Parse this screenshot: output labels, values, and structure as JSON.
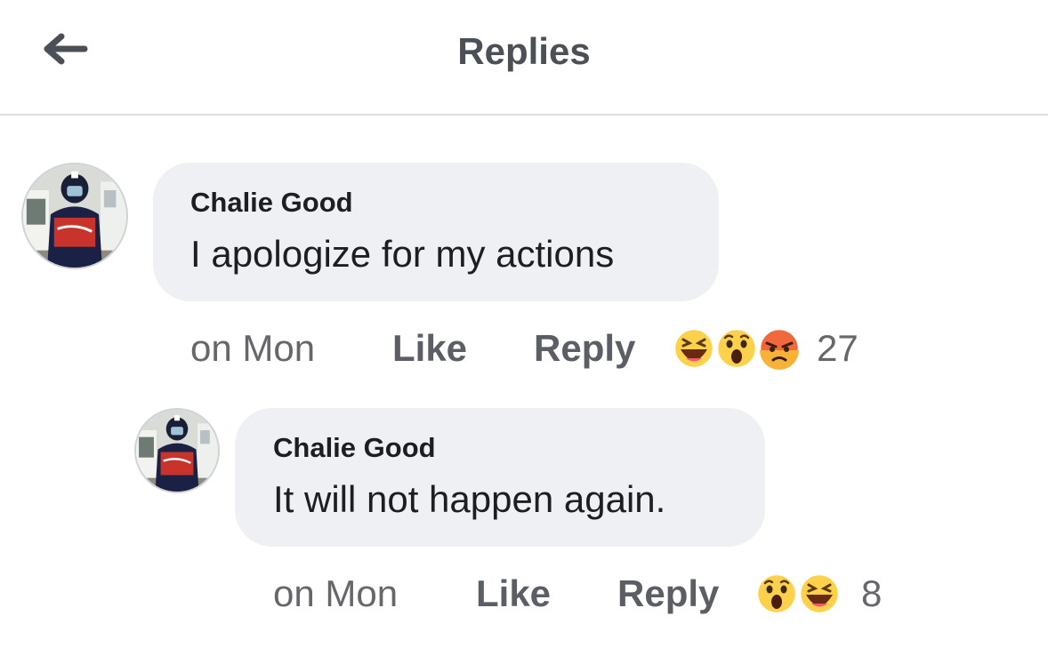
{
  "header": {
    "title": "Replies",
    "back_icon": "arrow-left-icon"
  },
  "comment": {
    "author": "Chalie Good",
    "text": "I apologize for my actions",
    "time": "on Mon",
    "like_label": "Like",
    "reply_label": "Reply",
    "reactions": [
      "haha",
      "wow",
      "angry"
    ],
    "reaction_count": "27"
  },
  "reply": {
    "author": "Chalie Good",
    "text": "It will not happen again.",
    "time": "on Mon",
    "like_label": "Like",
    "reply_label": "Reply",
    "reactions": [
      "wow",
      "haha"
    ],
    "reaction_count": "8"
  },
  "colors": {
    "bubble": "#eff0f3",
    "divider": "#dadde1",
    "haha_face": "#fdd14b",
    "angry_face": "#f0683b"
  }
}
